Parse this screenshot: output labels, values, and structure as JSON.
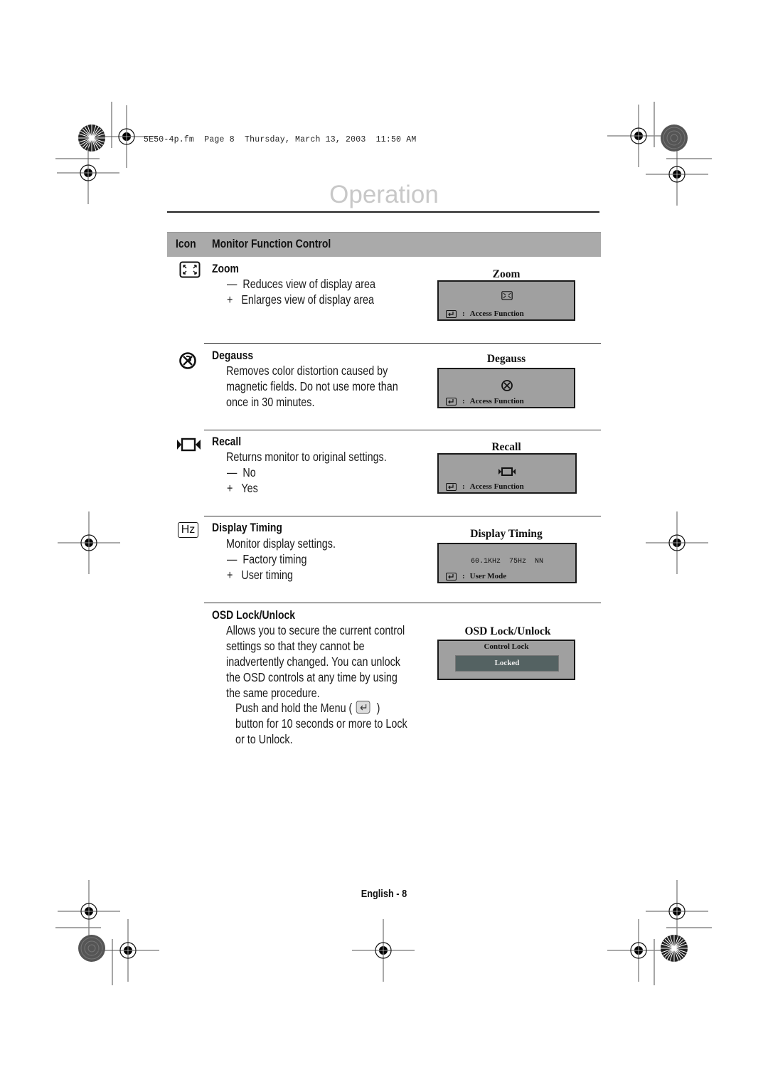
{
  "header": {
    "file_info": "5E50-4p.fm  Page 8  Thursday, March 13, 2003  11:50 AM"
  },
  "page_title": "Operation",
  "table": {
    "col_icon": "Icon",
    "col_control": "Monitor Function Control"
  },
  "sections": [
    {
      "title": "Zoom",
      "icon": "zoom-arrows-icon",
      "lines": [
        {
          "prefix": "—",
          "text": "Reduces view of display area"
        },
        {
          "prefix": "+",
          "text": "Enlarges view of display area"
        }
      ],
      "osd": {
        "caption": "Zoom",
        "icon": "zoom-arrows-icon",
        "footer": "Access Function"
      }
    },
    {
      "title": "Degauss",
      "icon": "degauss-icon",
      "lines": [
        {
          "prefix": "",
          "text": "Removes color distortion caused by"
        },
        {
          "prefix": "",
          "text": "magnetic fields. Do not use more than"
        },
        {
          "prefix": "",
          "text": "once in 30 minutes."
        }
      ],
      "osd": {
        "caption": "Degauss",
        "icon": "degauss-icon",
        "footer": "Access Function"
      }
    },
    {
      "title": "Recall",
      "icon": "recall-icon",
      "lines": [
        {
          "prefix": "",
          "text": "Returns monitor to original settings."
        },
        {
          "prefix": "—",
          "text": "No"
        },
        {
          "prefix": "+",
          "text": "Yes"
        }
      ],
      "osd": {
        "caption": "Recall",
        "icon": "recall-icon",
        "footer": "Access Function"
      }
    },
    {
      "title": "Display Timing",
      "icon": "hz-icon",
      "icon_text": "Hz",
      "lines": [
        {
          "prefix": "",
          "text": "Monitor display settings."
        },
        {
          "prefix": "—",
          "text": "Factory timing"
        },
        {
          "prefix": "+",
          "text": "User timing"
        }
      ],
      "osd": {
        "caption": "Display Timing",
        "readout": "60.1KHz  75Hz  NN",
        "footer": "User Mode"
      }
    },
    {
      "title": "OSD Lock/Unlock",
      "lines": [
        {
          "text": "Allows you to secure the current control"
        },
        {
          "text": "settings so that they cannot be"
        },
        {
          "text": "inadvertently changed. You can unlock"
        },
        {
          "text": "the OSD controls at any time by using"
        },
        {
          "text": "the same procedure."
        }
      ],
      "instruction": {
        "line1_before": "Push and hold the Menu (",
        "line1_after": ")",
        "line2": "button for 10 seconds or more to Lock",
        "line3": "or to Unlock."
      },
      "osd": {
        "caption": "OSD Lock/Unlock",
        "label": "Control Lock",
        "status": "Locked"
      }
    }
  ],
  "footer": {
    "page_label": "English - 8"
  }
}
